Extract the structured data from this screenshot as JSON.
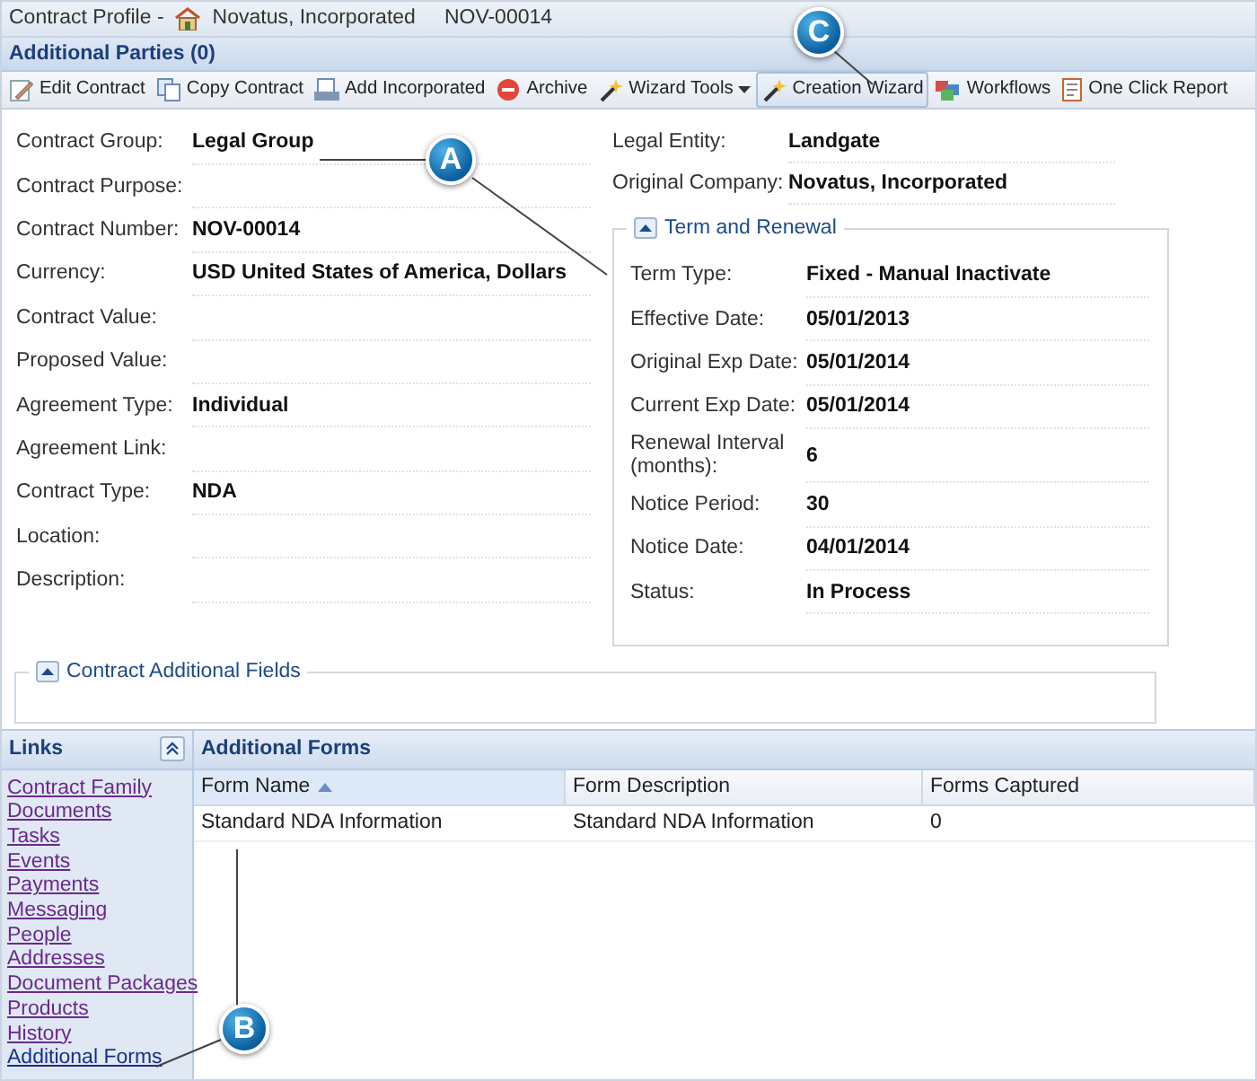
{
  "header": {
    "title": "Contract Profile -",
    "company": "Novatus, Incorporated",
    "contract_id": "NOV-00014"
  },
  "parties_bar": {
    "title": "Additional Parties (0)"
  },
  "toolbar": [
    {
      "label": "Edit Contract",
      "selected": false,
      "dropdown": false
    },
    {
      "label": "Copy Contract",
      "selected": false,
      "dropdown": false
    },
    {
      "label": "Add Incorporated",
      "selected": false,
      "dropdown": false
    },
    {
      "label": "Archive",
      "selected": false,
      "dropdown": false
    },
    {
      "label": "Wizard Tools",
      "selected": false,
      "dropdown": true
    },
    {
      "label": "Creation Wizard",
      "selected": true,
      "dropdown": false
    },
    {
      "label": "Workflows",
      "selected": false,
      "dropdown": false
    },
    {
      "label": "One Click Report",
      "selected": false,
      "dropdown": false
    }
  ],
  "left_fields": [
    {
      "label": "Contract Group:",
      "value": "Legal Group"
    },
    {
      "label": "Contract Purpose:"
    },
    {
      "label": "Contract Number:",
      "value": "NOV-00014"
    },
    {
      "label": "Currency:",
      "value": "USD United States of America, Dollars"
    },
    {
      "label": "Contract Value:"
    },
    {
      "label": "Proposed Value:"
    },
    {
      "label": "Agreement Type:",
      "value": "Individual"
    },
    {
      "label": "Agreement Link:"
    },
    {
      "label": "Contract Type:",
      "value": "NDA"
    },
    {
      "label": "Location:"
    },
    {
      "label": "Description:"
    }
  ],
  "right_fields": [
    {
      "label": "Legal Entity:",
      "value": "Landgate"
    },
    {
      "label": "Original Company:",
      "value": "Novatus, Incorporated"
    }
  ],
  "term_and_renewal": {
    "title": "Term and Renewal",
    "expanded": true,
    "fields": [
      {
        "label": "Term Type:",
        "value": "Fixed - Manual Inactivate"
      },
      {
        "label": "Effective Date:",
        "value": "05/01/2013"
      },
      {
        "label": "Original Exp Date:",
        "value": "05/01/2014"
      },
      {
        "label": "Current Exp Date:",
        "value": "05/01/2014"
      },
      {
        "label": "Renewal Interval (months):",
        "value": "6"
      },
      {
        "label": "Notice Period:",
        "value": "30"
      },
      {
        "label": "Notice Date:",
        "value": "04/01/2014"
      },
      {
        "label": "Status:",
        "value": "In Process"
      }
    ]
  },
  "additional_fields": {
    "title": "Contract Additional Fields",
    "expanded": true
  },
  "links": {
    "title": "Links",
    "items": [
      {
        "label": "Contract Family",
        "selected": false
      },
      {
        "label": "Documents",
        "selected": false
      },
      {
        "label": "Tasks",
        "selected": false
      },
      {
        "label": "Events",
        "selected": false
      },
      {
        "label": "Payments",
        "selected": false
      },
      {
        "label": "Messaging",
        "selected": false
      },
      {
        "label": "People",
        "selected": false
      },
      {
        "label": "Addresses",
        "selected": false
      },
      {
        "label": "Document Packages",
        "selected": false
      },
      {
        "label": "Products",
        "selected": false
      },
      {
        "label": "History",
        "selected": false
      },
      {
        "label": "Additional Forms",
        "selected": true
      }
    ]
  },
  "forms": {
    "title": "Additional Forms",
    "columns": [
      {
        "label": "Form Name",
        "sorted": true
      },
      {
        "label": "Form Description",
        "sorted": false
      },
      {
        "label": "Forms Captured",
        "sorted": false
      }
    ],
    "rows": [
      [
        "Standard NDA Information",
        "Standard NDA Information",
        "0"
      ]
    ]
  },
  "callouts": [
    {
      "label": "A"
    },
    {
      "label": "B"
    },
    {
      "label": "C"
    }
  ]
}
